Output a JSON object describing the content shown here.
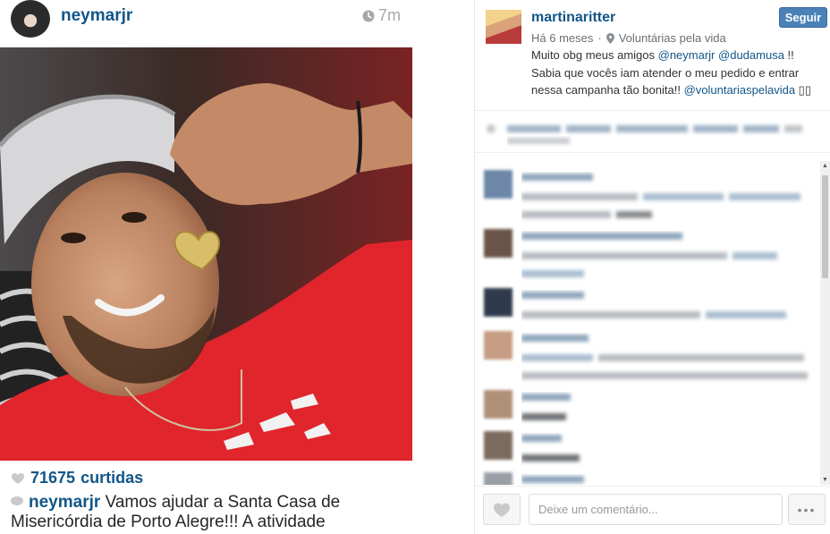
{
  "post": {
    "username": "neymarjr",
    "time": "7m",
    "likes_count": "71675",
    "likes_label": "curtidas",
    "caption_user": "neymarjr",
    "caption_text": "Vamos ajudar a Santa Casa de Misericórdia de Porto Alegre!!! A atividade"
  },
  "detail": {
    "username": "martinaritter",
    "follow_label": "Seguir",
    "age": "Há 6 meses",
    "location": "Voluntárias pela vida",
    "desc_part1": "Muito obg meus amigos ",
    "mention1": "@neymarjr",
    "desc_sep": " ",
    "mention2": "@dudamusa",
    "desc_part2": " !! Sabia que vocês iam atender o meu pedido e entrar nessa campanha tão bonita!! ",
    "mention3": "@voluntariaspelavida",
    "desc_tail": " ▯▯",
    "comment_placeholder": "Deixe um comentário...",
    "more_label": "•••"
  },
  "colors": {
    "link": "#125688",
    "follow_bg": "#4a81b7",
    "muted": "#a5a7aa"
  },
  "icons": [
    "clock-icon",
    "heart-icon",
    "speech-bubble-icon",
    "pin-icon",
    "more-icon"
  ]
}
